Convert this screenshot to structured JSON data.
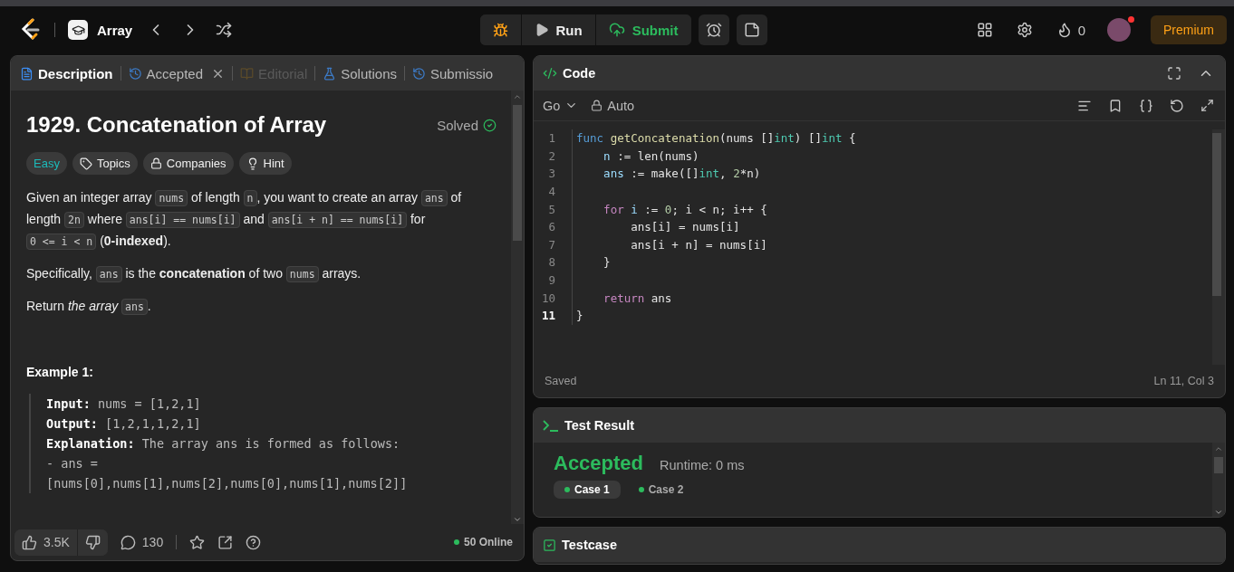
{
  "header": {
    "problem_list_title": "Array",
    "run_label": "Run",
    "submit_label": "Submit",
    "streak_count": "0",
    "premium_label": "Premium",
    "has_notification": true
  },
  "description_panel": {
    "tabs": [
      {
        "label": "Description",
        "kind": "description",
        "selected": true,
        "disabled": false,
        "closable": false
      },
      {
        "label": "Accepted",
        "kind": "history",
        "selected": false,
        "disabled": false,
        "closable": true
      },
      {
        "label": "Editorial",
        "kind": "book",
        "selected": false,
        "disabled": true,
        "closable": false
      },
      {
        "label": "Solutions",
        "kind": "flask",
        "selected": false,
        "disabled": false,
        "closable": false
      },
      {
        "label": "Submissio",
        "kind": "history",
        "selected": false,
        "disabled": false,
        "closable": false
      }
    ],
    "title": "1929. Concatenation of Array",
    "status": "Solved",
    "tags": [
      {
        "label": "Easy",
        "kind": "difficulty"
      },
      {
        "label": "Topics",
        "kind": "tag"
      },
      {
        "label": "Companies",
        "kind": "lock"
      },
      {
        "label": "Hint",
        "kind": "bulb"
      }
    ],
    "paragraphs": [
      [
        {
          "kind": "text",
          "text": "Given an integer array "
        },
        {
          "kind": "code",
          "text": "nums"
        },
        {
          "kind": "text",
          "text": " of length "
        },
        {
          "kind": "code",
          "text": "n"
        },
        {
          "kind": "text",
          "text": ", you want to create an array "
        },
        {
          "kind": "code",
          "text": "ans"
        },
        {
          "kind": "text",
          "text": " of length "
        },
        {
          "kind": "code",
          "text": "2n"
        },
        {
          "kind": "text",
          "text": " where "
        },
        {
          "kind": "code",
          "text": "ans[i] == nums[i]"
        },
        {
          "kind": "text",
          "text": " and "
        },
        {
          "kind": "code",
          "text": "ans[i + n] == nums[i]"
        },
        {
          "kind": "text",
          "text": " for "
        },
        {
          "kind": "code",
          "text": "0 <= i < n"
        },
        {
          "kind": "text",
          "text": " ("
        },
        {
          "kind": "bold",
          "text": "0-indexed"
        },
        {
          "kind": "text",
          "text": ")."
        }
      ],
      [
        {
          "kind": "text",
          "text": "Specifically, "
        },
        {
          "kind": "code",
          "text": "ans"
        },
        {
          "kind": "text",
          "text": " is the "
        },
        {
          "kind": "bold",
          "text": "concatenation"
        },
        {
          "kind": "text",
          "text": " of two "
        },
        {
          "kind": "code",
          "text": "nums"
        },
        {
          "kind": "text",
          "text": " arrays."
        }
      ],
      [
        {
          "kind": "text",
          "text": "Return "
        },
        {
          "kind": "italic",
          "text": "the array "
        },
        {
          "kind": "code",
          "text": "ans"
        },
        {
          "kind": "text",
          "text": "."
        }
      ]
    ],
    "example_title": "Example 1:",
    "example_lines": [
      {
        "label": "Input:",
        "text": "nums = [1,2,1]"
      },
      {
        "label": "Output:",
        "text": "[1,2,1,1,2,1]"
      },
      {
        "label": "Explanation:",
        "text": "The array ans is formed as follows:"
      },
      {
        "text": "- ans ="
      },
      {
        "text": "[nums[0],nums[1],nums[2],nums[0],nums[1],nums[2]]"
      }
    ],
    "likes": "3.5K",
    "comments": "130",
    "online": "50 Online"
  },
  "code_panel": {
    "title": "Code",
    "language": "Go",
    "mode": "Auto",
    "lines": [
      {
        "number": "1",
        "current": false,
        "tokens": [
          {
            "kind": "keyword",
            "text": "func"
          },
          {
            "kind": "func",
            "text": " getConcatenation"
          },
          {
            "kind": "plain",
            "text": "(nums []"
          },
          {
            "kind": "type",
            "text": "int"
          },
          {
            "kind": "plain",
            "text": ") []"
          },
          {
            "kind": "type",
            "text": "int"
          },
          {
            "kind": "plain",
            "text": " {"
          }
        ]
      },
      {
        "number": "2",
        "current": false,
        "tokens": [
          {
            "kind": "var",
            "text": "    n"
          },
          {
            "kind": "plain",
            "text": " := len(nums)"
          }
        ]
      },
      {
        "number": "3",
        "current": false,
        "tokens": [
          {
            "kind": "var",
            "text": "    ans"
          },
          {
            "kind": "plain",
            "text": " := make([]"
          },
          {
            "kind": "type",
            "text": "int"
          },
          {
            "kind": "plain",
            "text": ", "
          },
          {
            "kind": "number",
            "text": "2"
          },
          {
            "kind": "plain",
            "text": "*n)"
          }
        ]
      },
      {
        "number": "4",
        "current": false
      },
      {
        "number": "5",
        "current": false,
        "tokens": [
          {
            "kind": "control",
            "text": "    for"
          },
          {
            "kind": "var",
            "text": " i"
          },
          {
            "kind": "plain",
            "text": " := "
          },
          {
            "kind": "number",
            "text": "0"
          },
          {
            "kind": "plain",
            "text": "; i < n; i++ {"
          }
        ]
      },
      {
        "number": "6",
        "current": false,
        "tokens": [
          {
            "kind": "plain",
            "text": "        ans[i] = nums[i]"
          }
        ]
      },
      {
        "number": "7",
        "current": false,
        "tokens": [
          {
            "kind": "plain",
            "text": "        ans[i + n] = nums[i]"
          }
        ]
      },
      {
        "number": "8",
        "current": false,
        "tokens": [
          {
            "kind": "plain",
            "text": "    }"
          }
        ]
      },
      {
        "number": "9",
        "current": false
      },
      {
        "number": "10",
        "current": false,
        "tokens": [
          {
            "kind": "control",
            "text": "    return"
          },
          {
            "kind": "plain",
            "text": " ans"
          }
        ]
      },
      {
        "number": "11",
        "current": true,
        "tokens": [
          {
            "kind": "plain",
            "text": "}"
          }
        ]
      }
    ],
    "save_status": "Saved",
    "cursor": "Ln 11, Col 3"
  },
  "test_result": {
    "title": "Test Result",
    "verdict": "Accepted",
    "runtime": "Runtime: 0 ms",
    "cases": [
      {
        "label": "Case 1",
        "selected": true
      },
      {
        "label": "Case 2",
        "selected": false
      }
    ]
  },
  "testcase": {
    "title": "Testcase"
  }
}
